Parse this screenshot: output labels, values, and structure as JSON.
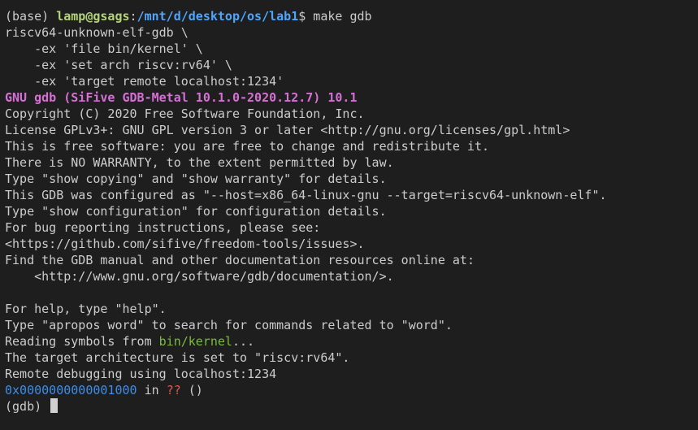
{
  "prompt": {
    "env": "(base)",
    "user_host": "lamp@gsags",
    "sep": ":",
    "path": "/mnt/d/desktop/os/lab1",
    "symbol": "$",
    "command": " make gdb"
  },
  "cmd_lines": [
    "riscv64-unknown-elf-gdb \\",
    "    -ex 'file bin/kernel' \\",
    "    -ex 'set arch riscv:rv64' \\",
    "    -ex 'target remote localhost:1234'"
  ],
  "gdb_banner": "GNU gdb (SiFive GDB-Metal 10.1.0-2020.12.7) 10.1",
  "info_lines": [
    "Copyright (C) 2020 Free Software Foundation, Inc.",
    "License GPLv3+: GNU GPL version 3 or later <http://gnu.org/licenses/gpl.html>",
    "This is free software: you are free to change and redistribute it.",
    "There is NO WARRANTY, to the extent permitted by law.",
    "Type \"show copying\" and \"show warranty\" for details.",
    "This GDB was configured as \"--host=x86_64-linux-gnu --target=riscv64-unknown-elf\".",
    "Type \"show configuration\" for configuration details.",
    "For bug reporting instructions, please see:",
    "<https://github.com/sifive/freedom-tools/issues>.",
    "Find the GDB manual and other documentation resources online at:",
    "    <http://www.gnu.org/software/gdb/documentation/>.",
    "",
    "For help, type \"help\".",
    "Type \"apropos word\" to search for commands related to \"word\"."
  ],
  "reading": {
    "prefix": "Reading symbols from ",
    "file": "bin/kernel",
    "suffix": "..."
  },
  "arch_line": "The target architecture is set to \"riscv:rv64\".",
  "remote_line": "Remote debugging using localhost:1234",
  "frame": {
    "address": "0x0000000000001000",
    "in": " in ",
    "func": "??",
    "args": " ()"
  },
  "gdb_prompt": "(gdb) "
}
